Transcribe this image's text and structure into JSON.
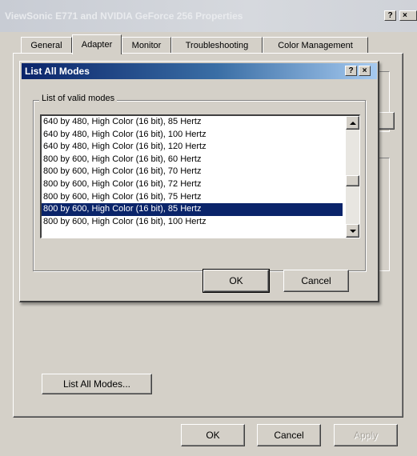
{
  "window": {
    "title": "ViewSonic E771 and NVIDIA GeForce 256 Properties",
    "help_label": "?",
    "close_label": "×"
  },
  "tabs": [
    {
      "label": "General"
    },
    {
      "label": "Adapter",
      "active": true
    },
    {
      "label": "Monitor"
    },
    {
      "label": "Troubleshooting"
    },
    {
      "label": "Color Management"
    }
  ],
  "adapter_page": {
    "list_all_modes_button": "List All Modes..."
  },
  "footer": {
    "ok_label": "OK",
    "cancel_label": "Cancel",
    "apply_label": "Apply"
  },
  "dialog": {
    "title": "List All Modes",
    "help_label": "?",
    "close_label": "×",
    "group_label": "List of valid modes",
    "modes": [
      "640 by 480, High Color (16 bit), 85 Hertz",
      "640 by 480, High Color (16 bit), 100 Hertz",
      "640 by 480, High Color (16 bit), 120 Hertz",
      "800 by 600, High Color (16 bit), 60 Hertz",
      "800 by 600, High Color (16 bit), 70 Hertz",
      "800 by 600, High Color (16 bit), 72 Hertz",
      "800 by 600, High Color (16 bit), 75 Hertz",
      "800 by 600, High Color (16 bit), 85 Hertz",
      "800 by 600, High Color (16 bit), 100 Hertz"
    ],
    "selected_index": 7,
    "scroll_position": 0.55,
    "ok_label": "OK",
    "cancel_label": "Cancel"
  },
  "colors": {
    "face": "#d4d0c8",
    "selection": "#0a246a",
    "dialog_title_start": "#0a246a",
    "dialog_title_end": "#a6caf0"
  }
}
